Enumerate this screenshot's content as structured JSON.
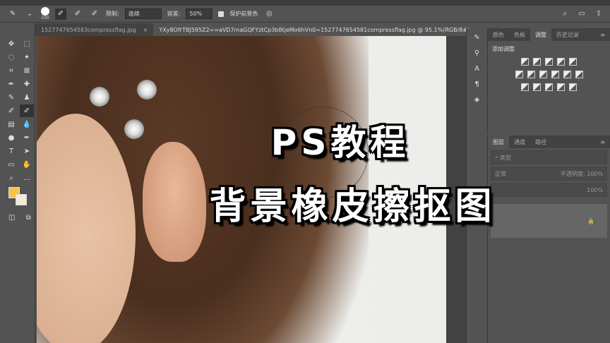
{
  "options": {
    "brush_size": "200",
    "limit_label": "限制:",
    "limit_value": "连续",
    "tolerance_label": "容差:",
    "tolerance_value": "50%",
    "protect_label": "保护前景色",
    "protect_checked": true
  },
  "tabs": [
    {
      "label": "1527747654583compressflag.jpg",
      "close": "×"
    },
    {
      "label": "YXy8OfrTBJ595Z2==aVD7maGQFYztCp3b8tjeMo6hVn0=1527747654581compressflag.jpg @ 95.1%(RGB/8#)",
      "close": "×"
    }
  ],
  "panel1": {
    "tabs": [
      "颜色",
      "色板",
      "调整",
      "历史记录"
    ],
    "active": 2,
    "heading": "添加调整"
  },
  "panel2": {
    "tabs": [
      "图层",
      "通道",
      "路径"
    ],
    "active": 0,
    "filter": "类型",
    "blend": "正常",
    "opacity_label": "不透明度:",
    "opacity": "100%",
    "fill": "100%"
  },
  "overlay": {
    "line1": "PS教程",
    "line2": "背景橡皮擦抠图"
  },
  "colors": {
    "foreground": "#f7c34a",
    "background": "#f2ead6"
  }
}
